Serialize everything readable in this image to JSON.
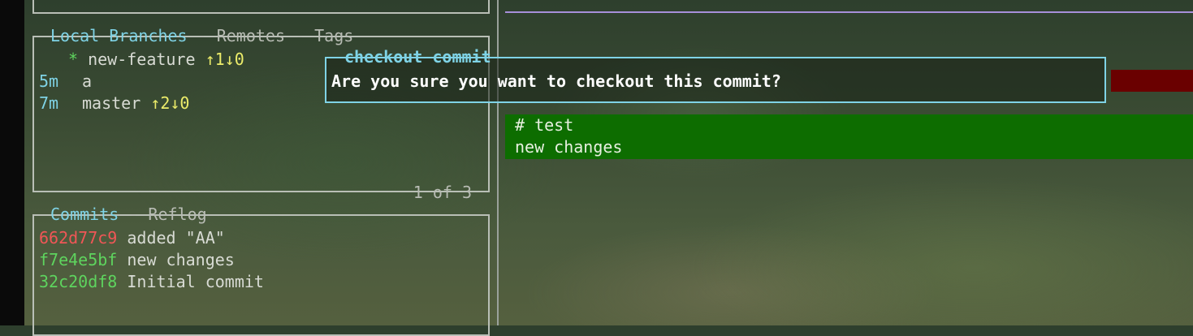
{
  "colors": {
    "active_title": "#7fd3e6",
    "current_branch_marker": "#5ed45e",
    "ahead_behind": "#ecec6a",
    "commit_hash_unpushed": "#f05656",
    "commit_hash_pushed": "#5ed45e",
    "diff_added_bg": "#0d6d00",
    "dialog_border": "#7fd3e6"
  },
  "branches_panel": {
    "tabs": [
      {
        "label": "Local Branches",
        "active": true
      },
      {
        "label": "Remotes",
        "active": false
      },
      {
        "label": "Tags",
        "active": false
      }
    ],
    "separator": " - ",
    "pager": "1 of 3",
    "items": [
      {
        "age": "",
        "marker": "*",
        "name": "new-feature",
        "tracking": "↑1↓0"
      },
      {
        "age": "5m",
        "marker": "",
        "name": "a",
        "tracking": ""
      },
      {
        "age": "7m",
        "marker": "",
        "name": "master",
        "tracking": "↑2↓0"
      }
    ]
  },
  "commits_panel": {
    "tabs": [
      {
        "label": "Commits",
        "active": true
      },
      {
        "label": "Reflog",
        "active": false
      }
    ],
    "separator": " - ",
    "items": [
      {
        "hash": "662d77c9",
        "message": "added \"AA\"",
        "status": "unpushed"
      },
      {
        "hash": "f7e4e5bf",
        "message": "new changes",
        "status": "pushed"
      },
      {
        "hash": "32c20df8",
        "message": "Initial commit",
        "status": "pushed"
      }
    ]
  },
  "diff": {
    "added_lines": [
      "# test",
      "new changes"
    ]
  },
  "dialog": {
    "title": "checkout commit",
    "message": "Are you sure you want to checkout this commit?"
  }
}
